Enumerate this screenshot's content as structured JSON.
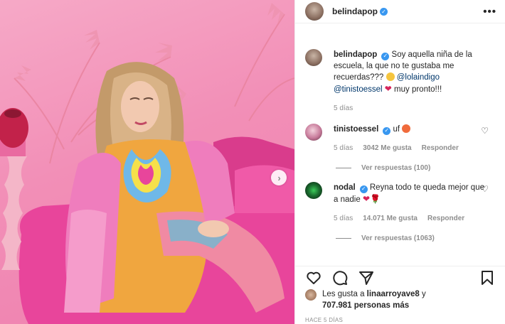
{
  "post": {
    "author": "belindapop",
    "caption_text": "Soy aquella niña de la escuela, la que no te gustaba me recuerdas???",
    "caption_mention1": "@lolaindigo",
    "caption_mention2": "@tinistoessel",
    "caption_end": "muy pronto!!!",
    "caption_time": "5 días"
  },
  "header": {
    "username": "belindapop",
    "more_icon": "more-horizontal-icon"
  },
  "comments": [
    {
      "username": "tinistoessel",
      "text": "uf",
      "time": "5 días",
      "likes": "3042 Me gusta",
      "reply": "Responder",
      "view_replies": "Ver respuestas (100)"
    },
    {
      "username": "nodal",
      "text": "Reyna todo te queda mejor que a nadie",
      "time": "5 días",
      "likes": "14.071 Me gusta",
      "reply": "Responder",
      "view_replies": "Ver respuestas (1063)"
    }
  ],
  "actions": [
    "heart-icon",
    "comment-icon",
    "share-icon",
    "bookmark-icon"
  ],
  "likes": {
    "prefix": "Les gusta a",
    "user": "linaarroyave8",
    "joiner": "y",
    "count": "707.981 personas más"
  },
  "timestamp": "HACE 5 DÍAS",
  "colors": {
    "link": "#00376b",
    "verified": "#3897f0",
    "muted": "#8e8e8e",
    "photo_bg": "#f28fb7"
  }
}
